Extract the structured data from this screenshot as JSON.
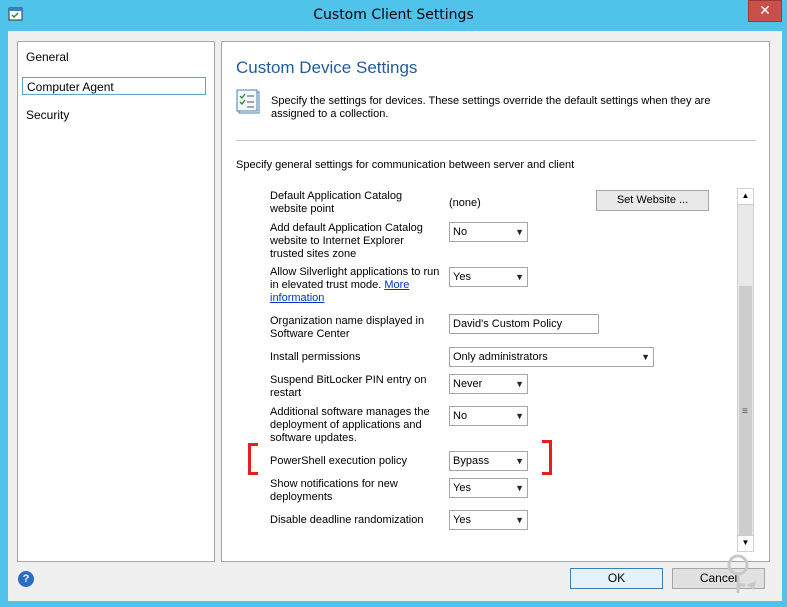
{
  "window": {
    "title": "Custom Client Settings",
    "close_label": "✕"
  },
  "nav": {
    "items": [
      {
        "label": "General"
      },
      {
        "label": "Computer Agent"
      },
      {
        "label": "Security"
      }
    ],
    "selected": "Computer Agent"
  },
  "panel": {
    "title": "Custom Device Settings",
    "description": "Specify the settings for devices. These settings override the default settings when they are assigned to a collection.",
    "general_text": "Specify general settings for communication between server and client"
  },
  "settings": {
    "catalog_website": {
      "label": "Default Application Catalog website point",
      "value": "(none)",
      "button": "Set Website ..."
    },
    "ie_trusted": {
      "label": "Add default Application Catalog website to Internet Explorer trusted sites zone",
      "value": "No"
    },
    "silverlight": {
      "label": "Allow Silverlight applications to run in elevated trust mode.",
      "link": "More information",
      "value": "Yes"
    },
    "org_name": {
      "label": "Organization name displayed in Software Center",
      "value": "David's Custom Policy"
    },
    "install_perm": {
      "label": "Install permissions",
      "value": "Only administrators"
    },
    "bitlocker": {
      "label": "Suspend BitLocker PIN entry on restart",
      "value": "Never"
    },
    "additional_sw": {
      "label": "Additional software manages the deployment of applications and software updates.",
      "value": "No"
    },
    "powershell": {
      "label": "PowerShell execution policy",
      "value": "Bypass"
    },
    "notifications": {
      "label": "Show notifications for new deployments",
      "value": "Yes"
    },
    "deadline": {
      "label": "Disable deadline randomization",
      "value": "Yes"
    }
  },
  "footer": {
    "ok_label": "OK",
    "cancel_label": "Cancel",
    "help_label": "?"
  },
  "colors": {
    "titlebar": "#4fc3ea",
    "accent_title": "#1f5c99",
    "highlight": "#e81e1e",
    "link": "#0033cc"
  },
  "icons": {
    "app": "settings-window-icon",
    "help": "help-icon",
    "dropdown": "chevron-down-icon",
    "description": "checklist-icon"
  }
}
